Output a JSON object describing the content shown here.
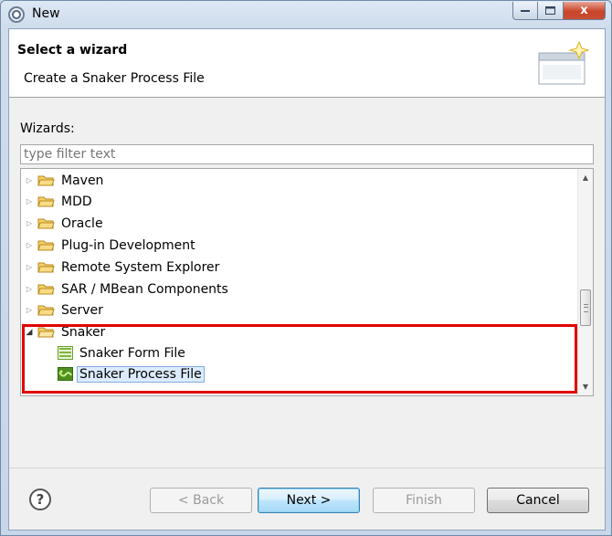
{
  "window": {
    "title": "New",
    "controls": {
      "minimize": "–",
      "maximize": "□",
      "close": "x"
    }
  },
  "header": {
    "title": "Select a wizard",
    "description": "Create a Snaker Process File"
  },
  "wizards_label": "Wizards:",
  "filter": {
    "value": "",
    "placeholder": "type filter text"
  },
  "tree": {
    "items": [
      {
        "label": "Maven",
        "expanded": false
      },
      {
        "label": "MDD",
        "expanded": false
      },
      {
        "label": "Oracle",
        "expanded": false
      },
      {
        "label": "Plug-in Development",
        "expanded": false
      },
      {
        "label": "Remote System Explorer",
        "expanded": false
      },
      {
        "label": "SAR / MBean Components",
        "expanded": false
      },
      {
        "label": "Server",
        "expanded": false
      },
      {
        "label": "Snaker",
        "expanded": true
      }
    ],
    "snaker_children": [
      {
        "label": "Snaker Form File",
        "icon": "form-file-icon"
      },
      {
        "label": "Snaker Process File",
        "icon": "process-file-icon",
        "selected": true
      }
    ]
  },
  "buttons": {
    "back": "< Back",
    "next": "Next >",
    "finish": "Finish",
    "cancel": "Cancel",
    "help": "?"
  },
  "colors": {
    "highlight": "#e00000",
    "selection": "#dcebfc"
  }
}
